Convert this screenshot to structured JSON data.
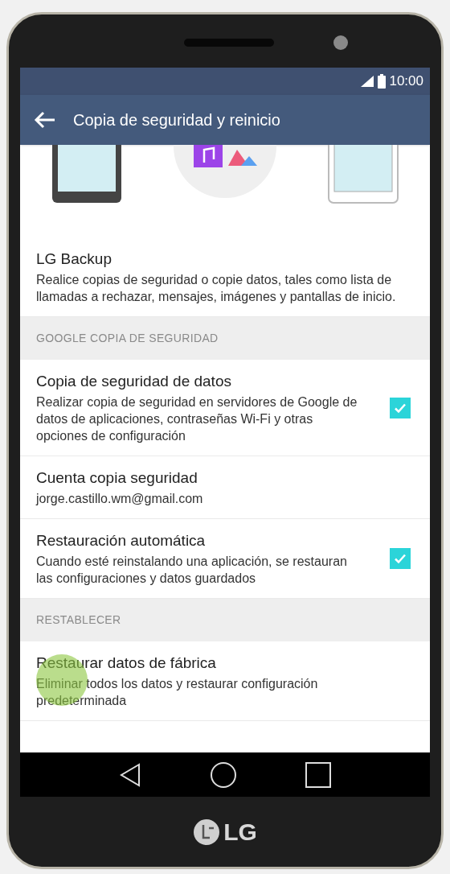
{
  "status_bar": {
    "time": "10:00"
  },
  "app_bar": {
    "title": "Copia de seguridad y reinicio"
  },
  "items": [
    {
      "kind": "plain",
      "title": "LG Backup",
      "summary": "Realice copias de seguridad o copie datos, tales como lista de llamadas a rechazar, mensajes, imágenes y pantallas de inicio."
    },
    {
      "kind": "header",
      "title": "GOOGLE COPIA DE SEGURIDAD"
    },
    {
      "kind": "check",
      "title": "Copia de seguridad de datos",
      "summary": "Realizar copia de seguridad en servidores de Google de datos de aplicaciones, contraseñas Wi-Fi y otras opciones de configuración",
      "checked": true
    },
    {
      "kind": "plain",
      "title": "Cuenta copia seguridad",
      "summary": "jorge.castillo.wm@gmail.com"
    },
    {
      "kind": "check",
      "title": "Restauración automática",
      "summary": "Cuando esté reinstalando una aplicación, se restauran las configuraciones y datos guardados",
      "checked": true
    },
    {
      "kind": "header",
      "title": "RESTABLECER"
    },
    {
      "kind": "plain",
      "title": "Restaurar datos de fábrica",
      "summary": "Eliminar todos los datos y restaurar configuración predeterminada",
      "touched": true
    }
  ],
  "brand": "LG"
}
